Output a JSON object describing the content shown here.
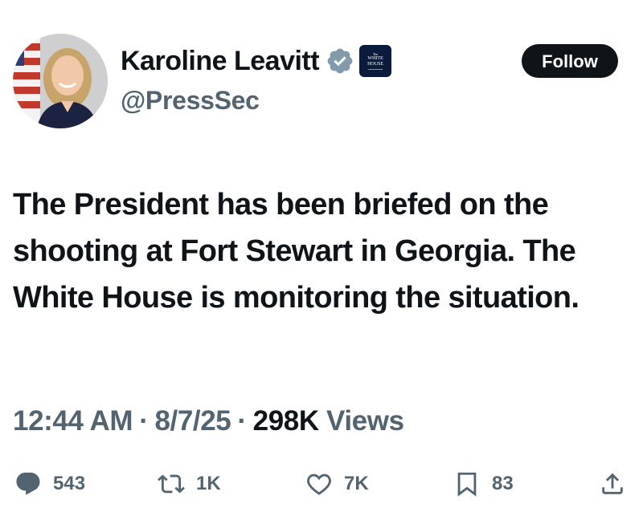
{
  "author": {
    "display_name": "Karoline Leavitt",
    "handle": "@PressSec",
    "affiliation_badge": {
      "small_text": "The",
      "line1": "WHITE",
      "line2": "HOUSE"
    },
    "verified_icon": "verified-badge-icon"
  },
  "follow_button": {
    "label": "Follow"
  },
  "tweet": {
    "text": "The President has been briefed on the shooting at Fort Stewart in Georgia. The White House is monitoring the situation."
  },
  "meta": {
    "time": "12:44 AM",
    "separator": "·",
    "date": "8/7/25",
    "views_count": "298K",
    "views_label": "Views"
  },
  "actions": {
    "replies": {
      "icon": "reply-icon",
      "count": "543"
    },
    "reposts": {
      "icon": "repost-icon",
      "count": "1K"
    },
    "likes": {
      "icon": "like-icon",
      "count": "7K"
    },
    "bookmarks": {
      "icon": "bookmark-icon",
      "count": "83"
    },
    "share": {
      "icon": "share-icon"
    }
  },
  "colors": {
    "text_primary": "#0f1419",
    "text_secondary": "#536471",
    "verified_fill": "#829aab",
    "follow_bg": "#0f1419",
    "badge_bg": "#0b1b3d"
  }
}
